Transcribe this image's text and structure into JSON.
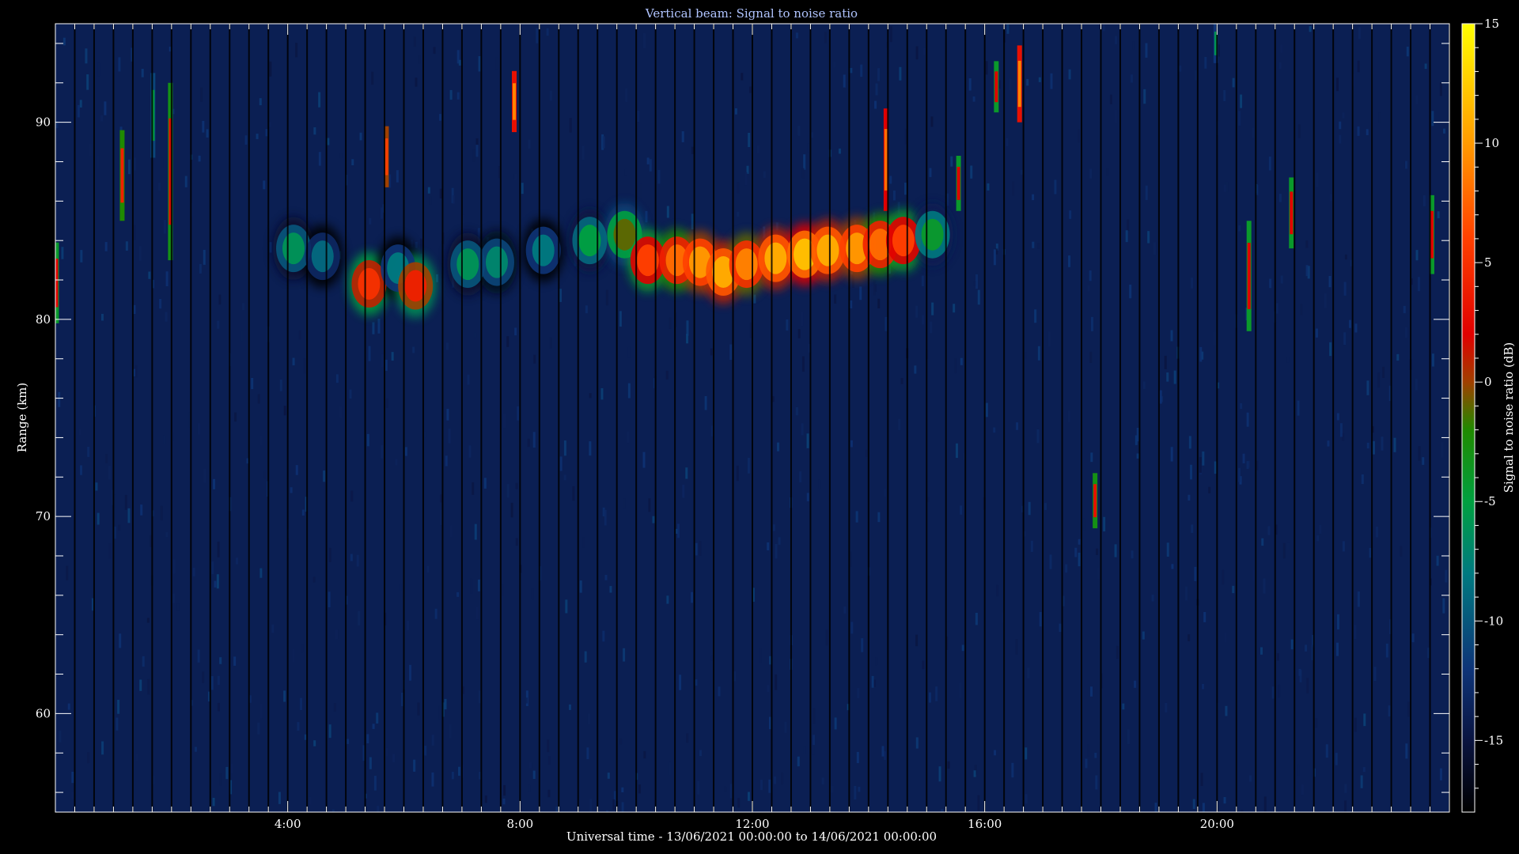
{
  "chart_data": {
    "type": "heatmap",
    "title": "Vertical beam: Signal to noise ratio",
    "xlabel": "Universal time - 13/06/2021 00:00:00 to 14/06/2021 00:00:00",
    "ylabel": "Range (km)",
    "colorbar_label": "Signal to noise ratio (dB)",
    "x_unit": "hours UT",
    "xlim": [
      0,
      24
    ],
    "ylim": [
      55,
      95
    ],
    "clim": [
      -18,
      15
    ],
    "x_ticks": [
      {
        "value": 4,
        "label": "4:00"
      },
      {
        "value": 8,
        "label": "8:00"
      },
      {
        "value": 12,
        "label": "12:00"
      },
      {
        "value": 16,
        "label": "16:00"
      },
      {
        "value": 20,
        "label": "20:00"
      }
    ],
    "y_ticks": [
      {
        "value": 60,
        "label": "60"
      },
      {
        "value": 70,
        "label": "70"
      },
      {
        "value": 80,
        "label": "80"
      },
      {
        "value": 90,
        "label": "90"
      }
    ],
    "c_ticks": [
      {
        "value": 15,
        "label": "15"
      },
      {
        "value": 10,
        "label": "10"
      },
      {
        "value": 5,
        "label": "5"
      },
      {
        "value": 0,
        "label": "0"
      },
      {
        "value": -5,
        "label": "-5"
      },
      {
        "value": -10,
        "label": "-10"
      },
      {
        "value": -15,
        "label": "-15"
      }
    ],
    "colorscale": [
      {
        "value": -18,
        "color": "#000000"
      },
      {
        "value": -15,
        "color": "#0a1440"
      },
      {
        "value": -12,
        "color": "#0e3478"
      },
      {
        "value": -8,
        "color": "#007a80"
      },
      {
        "value": -5,
        "color": "#00a040"
      },
      {
        "value": -2,
        "color": "#208a00"
      },
      {
        "value": 0,
        "color": "#a04000"
      },
      {
        "value": 2,
        "color": "#e00000"
      },
      {
        "value": 6,
        "color": "#ff4000"
      },
      {
        "value": 10,
        "color": "#ff9a00"
      },
      {
        "value": 15,
        "color": "#ffff00"
      }
    ],
    "background_snr": -14,
    "main_layer": [
      {
        "time": 4.1,
        "range": 83.6,
        "snr": -6
      },
      {
        "time": 4.6,
        "range": 83.2,
        "snr": -9
      },
      {
        "time": 5.4,
        "range": 81.8,
        "snr": 5
      },
      {
        "time": 5.9,
        "range": 82.6,
        "snr": -8
      },
      {
        "time": 6.2,
        "range": 81.7,
        "snr": 4
      },
      {
        "time": 7.1,
        "range": 82.8,
        "snr": -6
      },
      {
        "time": 7.6,
        "range": 82.9,
        "snr": -7
      },
      {
        "time": 8.4,
        "range": 83.5,
        "snr": -8
      },
      {
        "time": 9.2,
        "range": 84.0,
        "snr": -5
      },
      {
        "time": 9.8,
        "range": 84.3,
        "snr": -1
      },
      {
        "time": 10.2,
        "range": 83.0,
        "snr": 6
      },
      {
        "time": 10.7,
        "range": 83.0,
        "snr": 8
      },
      {
        "time": 11.1,
        "range": 82.9,
        "snr": 10
      },
      {
        "time": 11.5,
        "range": 82.4,
        "snr": 11
      },
      {
        "time": 11.9,
        "range": 82.8,
        "snr": 9
      },
      {
        "time": 12.4,
        "range": 83.1,
        "snr": 11
      },
      {
        "time": 12.9,
        "range": 83.3,
        "snr": 12
      },
      {
        "time": 13.3,
        "range": 83.5,
        "snr": 11
      },
      {
        "time": 13.8,
        "range": 83.6,
        "snr": 10
      },
      {
        "time": 14.2,
        "range": 83.8,
        "snr": 8
      },
      {
        "time": 14.6,
        "range": 84.0,
        "snr": 6
      },
      {
        "time": 15.1,
        "range": 84.3,
        "snr": -4
      }
    ],
    "vertical_streaks": [
      {
        "time": 1.15,
        "range_low": 85.0,
        "range_high": 89.6,
        "snr": 4
      },
      {
        "time": 1.68,
        "range_low": 88.2,
        "range_high": 92.5,
        "snr": -5
      },
      {
        "time": 1.98,
        "range_low": 83.0,
        "range_high": 92.0,
        "snr": 3
      },
      {
        "time": 5.7,
        "range_low": 86.7,
        "range_high": 89.8,
        "snr": 6
      },
      {
        "time": 7.9,
        "range_low": 89.5,
        "range_high": 92.6,
        "snr": 9
      },
      {
        "time": 14.3,
        "range_low": 85.5,
        "range_high": 90.7,
        "snr": 8
      },
      {
        "time": 15.55,
        "range_low": 85.5,
        "range_high": 88.3,
        "snr": 2
      },
      {
        "time": 16.2,
        "range_low": 90.5,
        "range_high": 93.1,
        "snr": 2
      },
      {
        "time": 16.6,
        "range_low": 90.0,
        "range_high": 93.9,
        "snr": 9
      },
      {
        "time": 17.9,
        "range_low": 69.4,
        "range_high": 72.2,
        "snr": 3
      },
      {
        "time": 19.98,
        "range_low": 93.0,
        "range_high": 95.0,
        "snr": -6
      },
      {
        "time": 20.55,
        "range_low": 79.4,
        "range_high": 85.0,
        "snr": 2
      },
      {
        "time": 21.28,
        "range_low": 83.6,
        "range_high": 87.2,
        "snr": 2
      },
      {
        "time": 23.7,
        "range_low": 82.3,
        "range_high": 86.3,
        "snr": 2
      },
      {
        "time": 0.02,
        "range_low": 79.8,
        "range_high": 83.9,
        "snr": 2
      }
    ]
  }
}
